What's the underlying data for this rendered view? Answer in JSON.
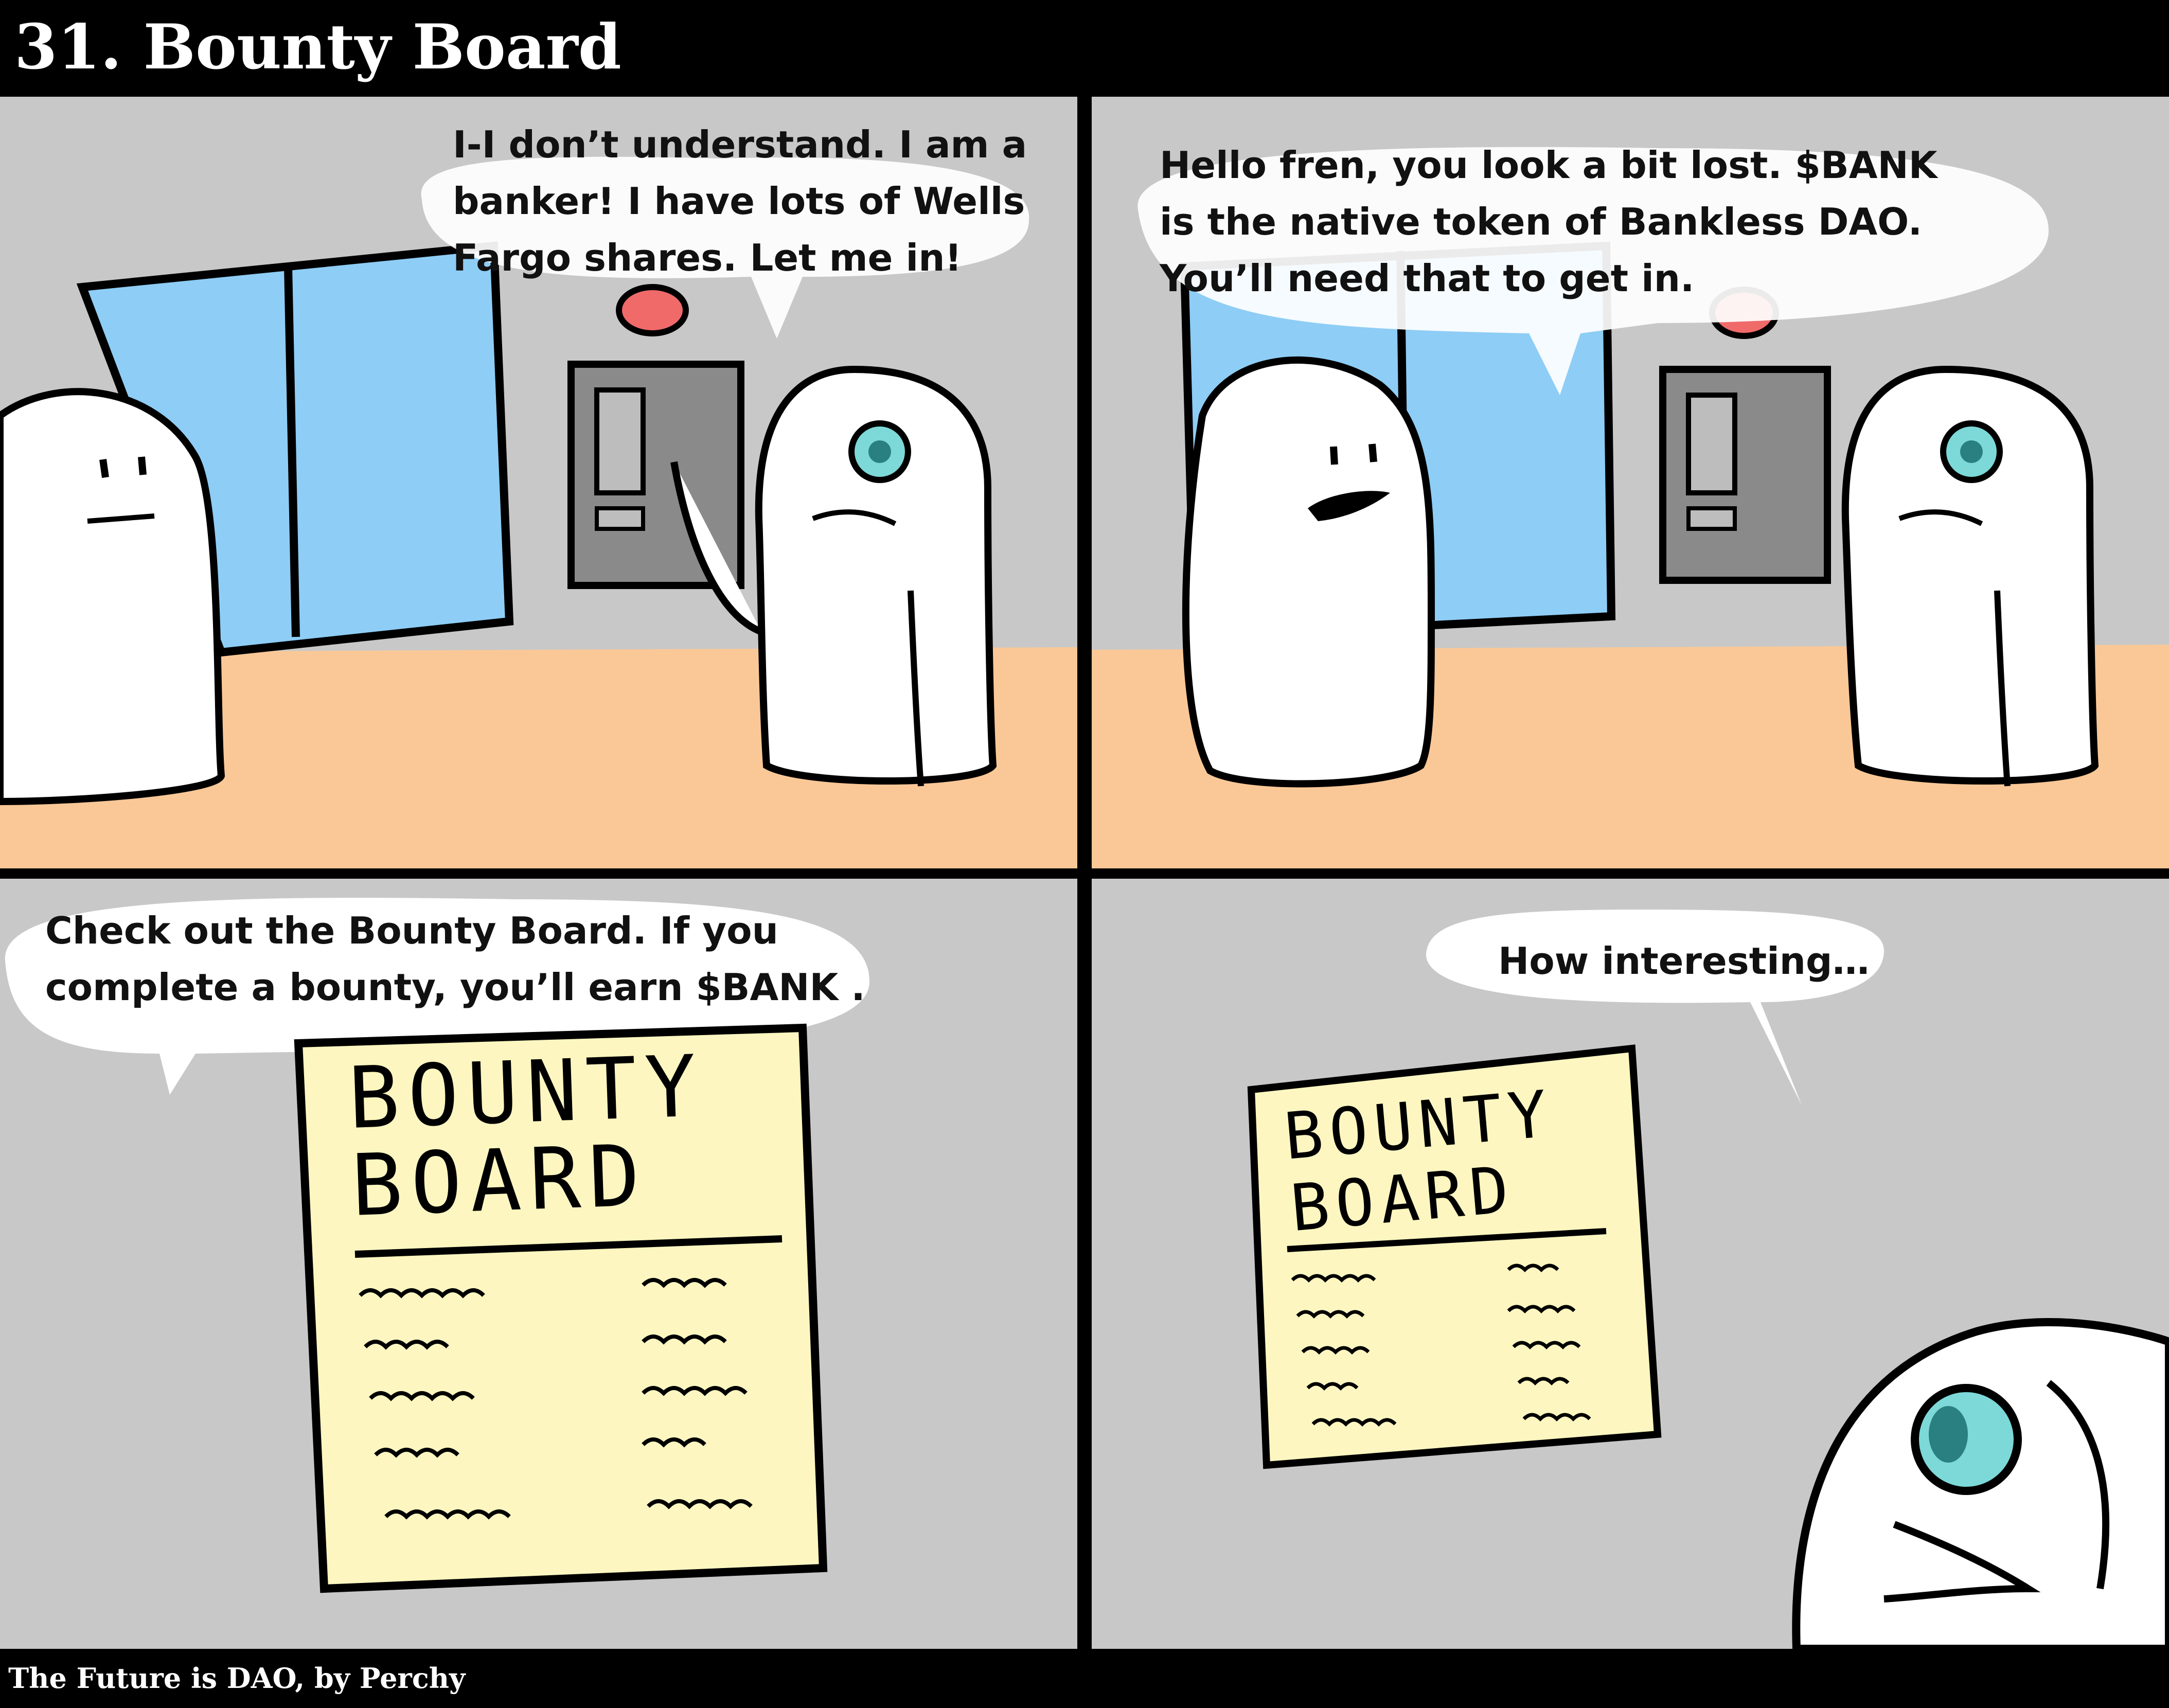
{
  "header": {
    "title": "31. Bounty Board"
  },
  "footer": {
    "credit": "The Future is DAO, by Perchy"
  },
  "panels": [
    {
      "speech": "I-I don’t understand. I am a\nbanker! I have lots of Wells\nFargo shares. Let me in!"
    },
    {
      "speech": "Hello fren, you look a bit lost. $BANK\nis the native token of Bankless DAO.\nYou’ll need that to get in."
    },
    {
      "speech": "Check out the Bounty Board. If you\ncomplete a bounty, you’ll earn $BANK .",
      "poster": {
        "line1": "BOUNTY",
        "line2": "BOARD"
      }
    },
    {
      "speech": "How interesting…",
      "poster": {
        "line1": "BOUNTY",
        "line2": "BOARD"
      }
    }
  ],
  "colors": {
    "wall": "#c8c8c8",
    "floor": "#fac897",
    "door": "#8ecdf5",
    "poster": "#fdf6c0",
    "button": "#f06a6a",
    "eye": "#7dd8d8"
  }
}
